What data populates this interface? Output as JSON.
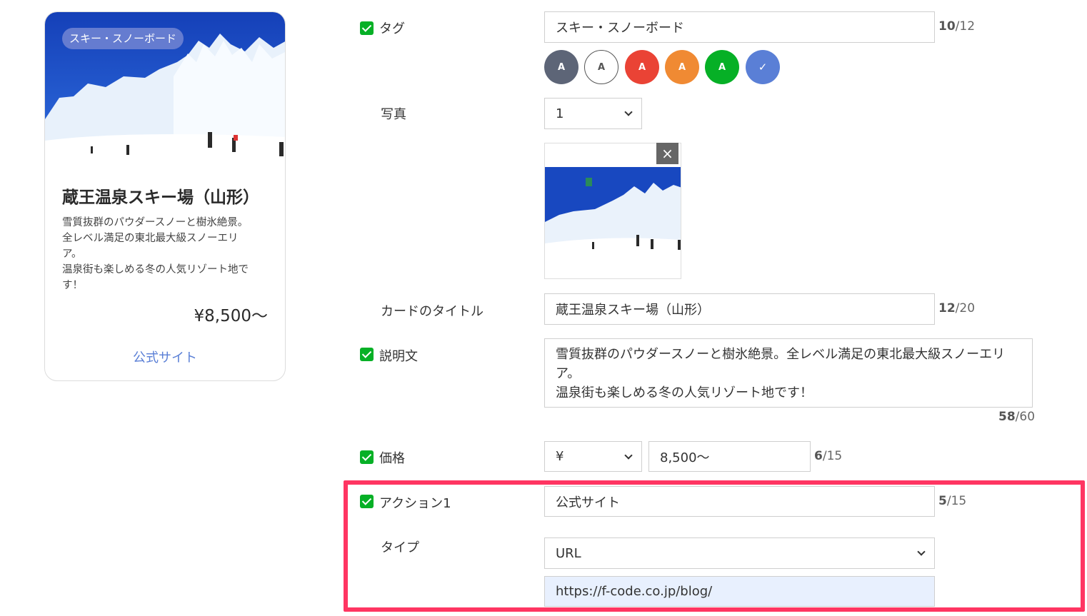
{
  "preview_card": {
    "tag": "スキー・スノーボード",
    "title": "蔵王温泉スキー場（山形）",
    "description": "雪質抜群のパウダースノーと樹氷絶景。\n全レベル満足の東北最大級スノーエリ\nア。\n温泉街も楽しめる冬の人気リゾート地で\nす！",
    "price": "¥8,500〜",
    "action_label": "公式サイト"
  },
  "form": {
    "tag": {
      "label": "タグ",
      "value": "スキー・スノーボード",
      "count": "10",
      "max": "/12",
      "swatches": [
        {
          "letter": "A",
          "color": "#5d6577",
          "text_color": "#ffffff"
        },
        {
          "letter": "A",
          "color": "#ffffff",
          "text_color": "#555555"
        },
        {
          "letter": "A",
          "color": "#ea4335",
          "text_color": "#ffffff"
        },
        {
          "letter": "A",
          "color": "#f08a33",
          "text_color": "#ffffff"
        },
        {
          "letter": "A",
          "color": "#06b026",
          "text_color": "#ffffff"
        },
        {
          "letter": "✓",
          "color": "#5a7fd6",
          "text_color": "#ffffff"
        }
      ]
    },
    "photo": {
      "label": "写真",
      "count_value": "1",
      "close_icon": "×"
    },
    "card_title": {
      "label": "カードのタイトル",
      "value": "蔵王温泉スキー場（山形）",
      "count": "12",
      "max": "/20"
    },
    "description": {
      "label": "説明文",
      "value": "雪質抜群のパウダースノーと樹氷絶景。全レベル満足の東北最大級スノーエリ\nア。\n温泉街も楽しめる冬の人気リゾート地です！",
      "count": "58",
      "max": "/60"
    },
    "price": {
      "label": "価格",
      "currency": "¥",
      "value": "8,500〜",
      "count": "6",
      "max": "/15"
    },
    "action1": {
      "label": "アクション1",
      "value": "公式サイト",
      "count": "5",
      "max": "/15",
      "type_label": "タイプ",
      "type_value": "URL",
      "url": "https://f-code.co.jp/blog/"
    }
  },
  "colors": {
    "checkbox": "#06b026",
    "highlight": "#ff3562",
    "link": "#5a7fd6",
    "url_field_bg": "#e8f0fe"
  }
}
